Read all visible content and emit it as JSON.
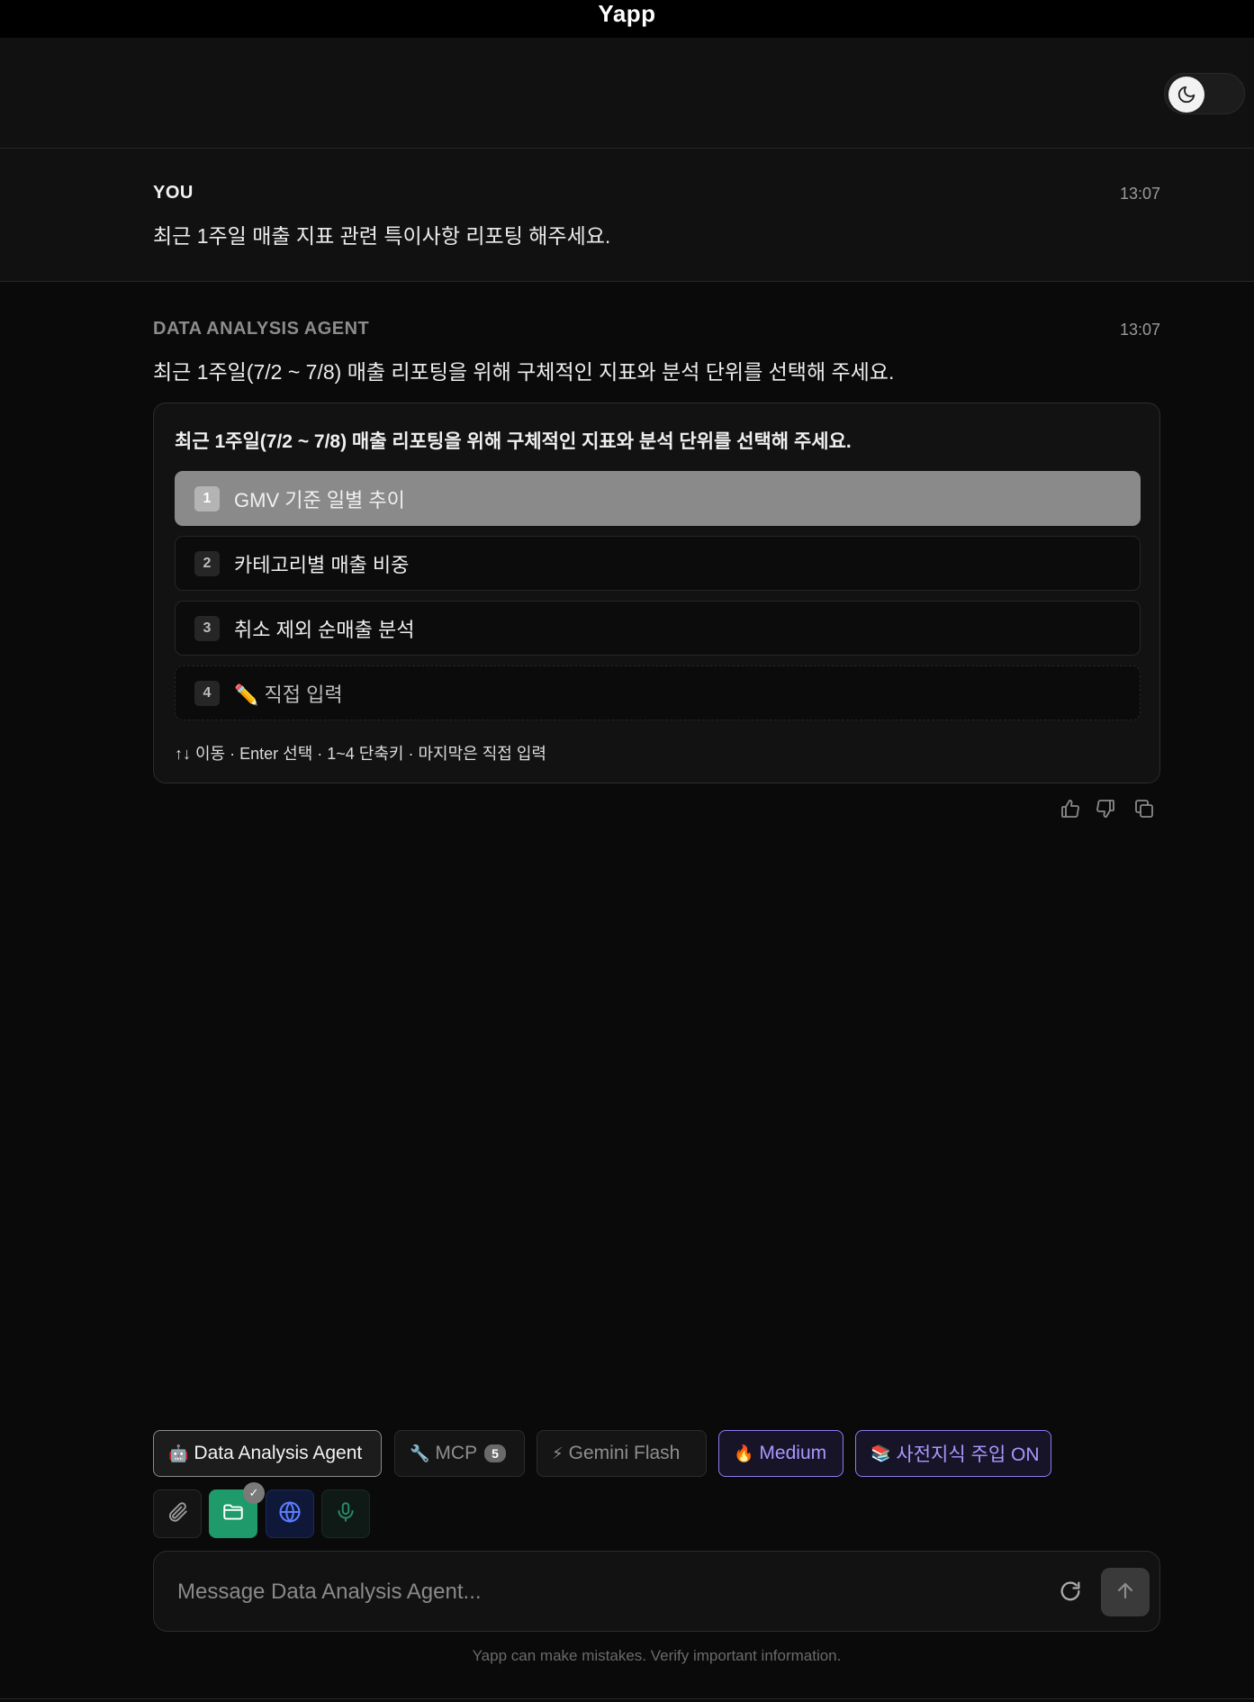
{
  "app": {
    "title": "Yapp"
  },
  "conversation": {
    "user_message": {
      "sender": "YOU",
      "time": "13:07",
      "text": "최근 1주일 매출 지표 관련 특이사항 리포팅 해주세요."
    },
    "agent_message": {
      "sender": "DATA ANALYSIS AGENT",
      "time": "13:07",
      "text": "최근 1주일(7/2 ~ 7/8) 매출 리포팅을 위해 구체적인 지표와 분석 단위를 선택해 주세요.",
      "choice_card": {
        "title": "최근 1주일(7/2 ~ 7/8) 매출 리포팅을 위해 구체적인 지표와 분석 단위를 선택해 주세요.",
        "options": [
          {
            "num": "1",
            "label": "GMV 기준 일별 추이",
            "selected": true
          },
          {
            "num": "2",
            "label": "카테고리별 매출 비중",
            "selected": false
          },
          {
            "num": "3",
            "label": "취소 제외 순매출 분석",
            "selected": false
          },
          {
            "num": "4",
            "label": "✏️ 직접 입력",
            "selected": false
          }
        ],
        "hint": "↑↓ 이동 · Enter 선택 · 1~4 단축키 · 마지막은 직접 입력"
      }
    }
  },
  "toolbar": {
    "agent": {
      "emoji": "🤖",
      "label": "Data Analysis Agent"
    },
    "mcp": {
      "emoji": "🔧",
      "label": "MCP",
      "count": "5"
    },
    "model": {
      "emoji": "⚡",
      "label": "Gemini Flash"
    },
    "effort": {
      "emoji": "🔥",
      "label": "Medium"
    },
    "knowledge": {
      "emoji": "📚",
      "label": "사전지식 주입 ON"
    },
    "files_check": "✓"
  },
  "composer": {
    "placeholder": "Message Data Analysis Agent..."
  },
  "footer": {
    "disclaimer": "Yapp can make mistakes. Verify important information."
  },
  "colors": {
    "accent_green": "#1f9a6a",
    "accent_violet": "#8d7cf0",
    "selected_option": "#8a8a8a"
  }
}
